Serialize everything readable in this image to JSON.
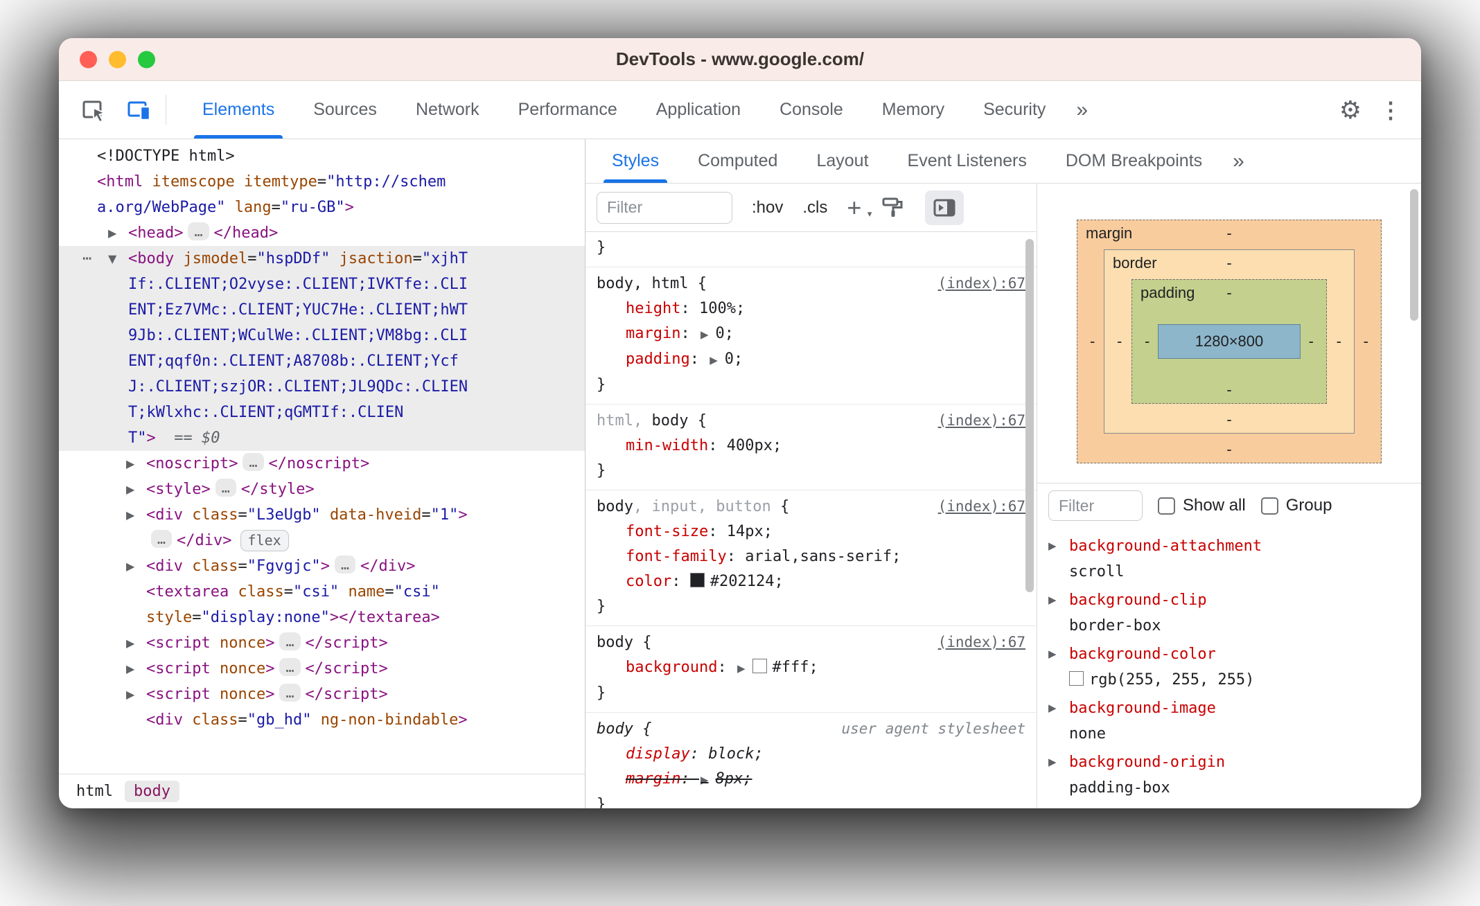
{
  "window": {
    "title": "DevTools - www.google.com/"
  },
  "toolbar": {
    "tabs": [
      {
        "label": "Elements",
        "active": true
      },
      {
        "label": "Sources"
      },
      {
        "label": "Network"
      },
      {
        "label": "Performance"
      },
      {
        "label": "Application"
      },
      {
        "label": "Console"
      },
      {
        "label": "Memory"
      },
      {
        "label": "Security"
      }
    ],
    "more_label": "»",
    "settings_icon": "⚙",
    "menu_icon": "⋮"
  },
  "elements_panel": {
    "tree": [
      {
        "lvl": 0,
        "segs": [
          [
            "<!DOCTYPE html>",
            "plain"
          ]
        ]
      },
      {
        "lvl": 0,
        "segs": [
          [
            "<html",
            "tag"
          ],
          [
            " ",
            "plain"
          ],
          [
            "itemscope",
            "attr"
          ],
          [
            " ",
            "plain"
          ],
          [
            "itemtype",
            "attr"
          ],
          [
            "=",
            "plain"
          ],
          [
            "\"http://schem",
            "val"
          ]
        ]
      },
      {
        "lvl": 0,
        "segs": [
          [
            "a.org/WebPage\"",
            "val"
          ],
          [
            " ",
            "plain"
          ],
          [
            "lang",
            "attr"
          ],
          [
            "=",
            "plain"
          ],
          [
            "\"ru-GB\"",
            "val"
          ],
          [
            ">",
            "tag"
          ]
        ]
      },
      {
        "lvl": 1,
        "arrow": "r",
        "segs": [
          [
            "<head>",
            "tag"
          ],
          [
            "…",
            "ell"
          ],
          [
            "</head>",
            "tag"
          ]
        ]
      },
      {
        "lvl": 1,
        "arrow": "d",
        "dots": true,
        "sel": true,
        "segs": [
          [
            "<body",
            "tag"
          ],
          [
            " ",
            "plain"
          ],
          [
            "jsmodel",
            "attr"
          ],
          [
            "=",
            "plain"
          ],
          [
            "\"hspDDf\"",
            "val"
          ],
          [
            " ",
            "plain"
          ],
          [
            "jsaction",
            "attr"
          ],
          [
            "=",
            "plain"
          ],
          [
            "\"xjhT",
            "val"
          ]
        ]
      },
      {
        "lvl": 1,
        "sel": true,
        "segs": [
          [
            "If:.CLIENT;O2vyse:.CLIENT;IVKTfe:.CLI",
            "val"
          ]
        ]
      },
      {
        "lvl": 1,
        "sel": true,
        "segs": [
          [
            "ENT;Ez7VMc:.CLIENT;YUC7He:.CLIENT;hWT",
            "val"
          ]
        ]
      },
      {
        "lvl": 1,
        "sel": true,
        "segs": [
          [
            "9Jb:.CLIENT;WCulWe:.CLIENT;VM8bg:.CLI",
            "val"
          ]
        ]
      },
      {
        "lvl": 1,
        "sel": true,
        "segs": [
          [
            "ENT;qqf0n:.CLIENT;A8708b:.CLIENT;Ycf",
            "val"
          ]
        ]
      },
      {
        "lvl": 1,
        "sel": true,
        "segs": [
          [
            "J:.CLIENT;szjOR:.CLIENT;JL9QDc:.CLIEN",
            "val"
          ]
        ]
      },
      {
        "lvl": 1,
        "sel": true,
        "segs": [
          [
            "T;kWlxhc:.CLIENT;qGMTIf:.CLIEN",
            "val"
          ]
        ]
      },
      {
        "lvl": 1,
        "sel": true,
        "segs": [
          [
            "T\"",
            "val"
          ],
          [
            ">",
            "tag"
          ],
          [
            "  ",
            "plain"
          ],
          [
            "== $0",
            "eq"
          ]
        ]
      },
      {
        "lvl": 2,
        "arrow": "r",
        "segs": [
          [
            "<noscript>",
            "tag"
          ],
          [
            "…",
            "ell"
          ],
          [
            "</noscript>",
            "tag"
          ]
        ]
      },
      {
        "lvl": 2,
        "arrow": "r",
        "segs": [
          [
            "<style>",
            "tag"
          ],
          [
            "…",
            "ell"
          ],
          [
            "</style>",
            "tag"
          ]
        ]
      },
      {
        "lvl": 2,
        "arrow": "r",
        "segs": [
          [
            "<div",
            "tag"
          ],
          [
            " ",
            "plain"
          ],
          [
            "class",
            "attr"
          ],
          [
            "=",
            "plain"
          ],
          [
            "\"L3eUgb\"",
            "val"
          ],
          [
            " ",
            "plain"
          ],
          [
            "data-hveid",
            "attr"
          ],
          [
            "=",
            "plain"
          ],
          [
            "\"1\"",
            "val"
          ],
          [
            ">",
            "tag"
          ]
        ]
      },
      {
        "lvl": 2,
        "segs": [
          [
            "…",
            "ell"
          ],
          [
            "</div>",
            "tag"
          ],
          [
            "flex",
            "badge"
          ]
        ]
      },
      {
        "lvl": 2,
        "arrow": "r",
        "segs": [
          [
            "<div",
            "tag"
          ],
          [
            " ",
            "plain"
          ],
          [
            "class",
            "attr"
          ],
          [
            "=",
            "plain"
          ],
          [
            "\"Fgvgjc\"",
            "val"
          ],
          [
            ">",
            "tag"
          ],
          [
            "…",
            "ell"
          ],
          [
            "</div>",
            "tag"
          ]
        ]
      },
      {
        "lvl": 2,
        "segs": [
          [
            "<textarea",
            "tag"
          ],
          [
            " ",
            "plain"
          ],
          [
            "class",
            "attr"
          ],
          [
            "=",
            "plain"
          ],
          [
            "\"csi\"",
            "val"
          ],
          [
            " ",
            "plain"
          ],
          [
            "name",
            "attr"
          ],
          [
            "=",
            "plain"
          ],
          [
            "\"csi\"",
            "val"
          ]
        ]
      },
      {
        "lvl": 2,
        "segs": [
          [
            "style",
            "attr"
          ],
          [
            "=",
            "plain"
          ],
          [
            "\"display:none\"",
            "val"
          ],
          [
            "></textarea>",
            "tag"
          ]
        ]
      },
      {
        "lvl": 2,
        "arrow": "r",
        "segs": [
          [
            "<script",
            "tag"
          ],
          [
            " ",
            "plain"
          ],
          [
            "nonce",
            "attr"
          ],
          [
            ">",
            "tag"
          ],
          [
            "…",
            "ell"
          ],
          [
            "</script>",
            "tag"
          ]
        ]
      },
      {
        "lvl": 2,
        "arrow": "r",
        "segs": [
          [
            "<script",
            "tag"
          ],
          [
            " ",
            "plain"
          ],
          [
            "nonce",
            "attr"
          ],
          [
            ">",
            "tag"
          ],
          [
            "…",
            "ell"
          ],
          [
            "</script>",
            "tag"
          ]
        ]
      },
      {
        "lvl": 2,
        "arrow": "r",
        "segs": [
          [
            "<script",
            "tag"
          ],
          [
            " ",
            "plain"
          ],
          [
            "nonce",
            "attr"
          ],
          [
            ">",
            "tag"
          ],
          [
            "…",
            "ell"
          ],
          [
            "</script>",
            "tag"
          ]
        ]
      },
      {
        "lvl": 2,
        "segs": [
          [
            "<div",
            "tag"
          ],
          [
            " ",
            "plain"
          ],
          [
            "class",
            "attr"
          ],
          [
            "=",
            "plain"
          ],
          [
            "\"gb_hd\"",
            "val"
          ],
          [
            " ",
            "plain"
          ],
          [
            "ng-non-bindable",
            "attr"
          ],
          [
            ">",
            "tag"
          ]
        ]
      }
    ],
    "breadcrumbs": [
      {
        "label": "html"
      },
      {
        "label": "body",
        "active": true
      }
    ]
  },
  "styles_panel": {
    "tabs": [
      {
        "label": "Styles",
        "active": true
      },
      {
        "label": "Computed"
      },
      {
        "label": "Layout"
      },
      {
        "label": "Event Listeners"
      },
      {
        "label": "DOM Breakpoints"
      }
    ],
    "more_label": "»",
    "filter_placeholder": "Filter",
    "hov_label": ":hov",
    "cls_label": ".cls",
    "new_rule_label": "+",
    "rules": [
      {
        "partial": true,
        "close": "}"
      },
      {
        "sel": [
          [
            "body",
            "m"
          ],
          [
            ", ",
            "m"
          ],
          [
            "html",
            "m"
          ],
          [
            " {",
            "m"
          ]
        ],
        "link": "(index):67",
        "link_type": "link",
        "props": [
          {
            "name": "height",
            "value": "100%"
          },
          {
            "name": "margin",
            "value": "0",
            "arrow": true
          },
          {
            "name": "padding",
            "value": "0",
            "arrow": true
          }
        ],
        "close": "}"
      },
      {
        "sel": [
          [
            "html",
            "u"
          ],
          [
            ", ",
            "u"
          ],
          [
            "body",
            "m"
          ],
          [
            " {",
            "m"
          ]
        ],
        "link": "(index):67",
        "link_type": "link",
        "props": [
          {
            "name": "min-width",
            "value": "400px"
          }
        ],
        "close": "}"
      },
      {
        "sel": [
          [
            "body",
            "m"
          ],
          [
            ", ",
            "u"
          ],
          [
            "input",
            "u"
          ],
          [
            ", ",
            "u"
          ],
          [
            "button",
            "u"
          ],
          [
            " {",
            "m"
          ]
        ],
        "link": "(index):67",
        "link_type": "link",
        "props": [
          {
            "name": "font-size",
            "value": "14px"
          },
          {
            "name": "font-family",
            "value": "arial,sans-serif"
          },
          {
            "name": "color",
            "value": "#202124",
            "swatch": "#202124"
          }
        ],
        "close": "}"
      },
      {
        "sel": [
          [
            "body",
            "m"
          ],
          [
            " {",
            "m"
          ]
        ],
        "link": "(index):67",
        "link_type": "link",
        "props": [
          {
            "name": "background",
            "value": "#fff",
            "arrow": true,
            "swatch": "#ffffff"
          }
        ],
        "close": "}"
      },
      {
        "sel": [
          [
            "body",
            "mi"
          ],
          [
            " {",
            "mi"
          ]
        ],
        "link": "user agent stylesheet",
        "link_type": "origin",
        "props": [
          {
            "name": "display",
            "value": "block",
            "italic": true
          },
          {
            "name": "margin",
            "value": "8px",
            "arrow": true,
            "strike": true,
            "italic": true
          }
        ],
        "close": "}"
      }
    ]
  },
  "computed_panel": {
    "box_model": {
      "margin_label": "margin",
      "border_label": "border",
      "padding_label": "padding",
      "content": "1280×800",
      "dash": "-"
    },
    "filter_placeholder": "Filter",
    "show_all_label": "Show all",
    "group_label": "Group",
    "properties": [
      {
        "name": "background-attachment",
        "value": "scroll"
      },
      {
        "name": "background-clip",
        "value": "border-box"
      },
      {
        "name": "background-color",
        "value": "rgb(255, 255, 255)",
        "swatch": "#ffffff"
      },
      {
        "name": "background-image",
        "value": "none"
      },
      {
        "name": "background-origin",
        "value": "padding-box"
      }
    ]
  }
}
